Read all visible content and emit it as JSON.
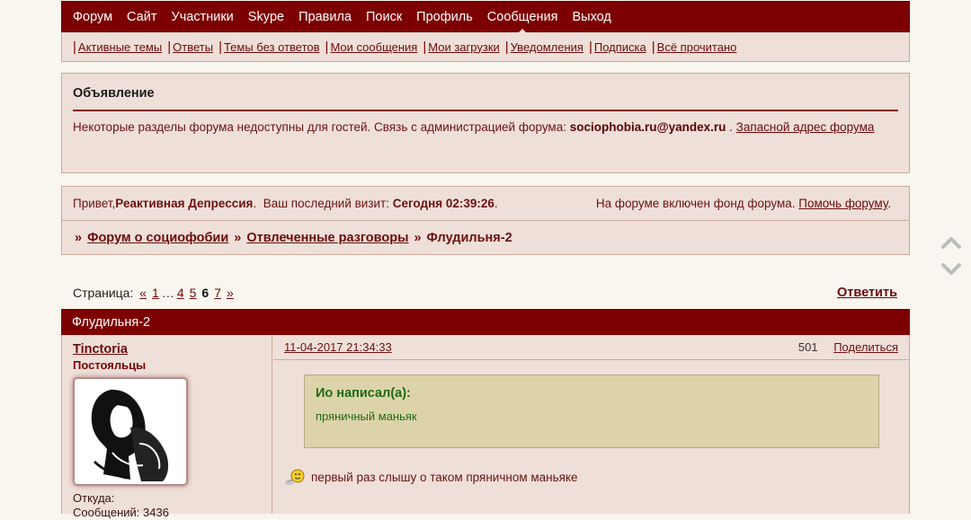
{
  "topnav": [
    "Форум",
    "Сайт",
    "Участники",
    "Skype",
    "Правила",
    "Поиск",
    "Профиль",
    "Сообщения",
    "Выход"
  ],
  "subnav": [
    "Активные темы",
    "Ответы",
    "Темы без ответов",
    "Мои сообщения",
    "Мои загрузки",
    "Уведомления ",
    "Подписка",
    "Всё прочитано"
  ],
  "announcement": {
    "title": "Объявление",
    "text": "Некоторые разделы форума недоступны для гостей. Связь с администрацией форума: ",
    "email": "sociophobia.ru@yandex.ru",
    "dot": " . ",
    "link": "Запасной адрес форума"
  },
  "welcome": {
    "greet": "Привет, ",
    "user": "Реактивная Депрессия",
    "last_label": ".  Ваш последний визит: ",
    "last_value": "Сегодня 02:39:26",
    "end": ".",
    "fund_text": "На форуме включен фонд форума. ",
    "fund_link": "Помочь форуму",
    "fund_end": "."
  },
  "breadcrumb": {
    "sep": "»",
    "items": [
      "Форум о социофобии",
      "Отвлеченные разговоры",
      "Флудильня-2"
    ]
  },
  "pager": {
    "label": "Страница: ",
    "prev": "«",
    "first": "1",
    "ellipsis": "…",
    "p4": "4",
    "p5": "5",
    "current": "6",
    "p7": "7",
    "next": "»"
  },
  "reply_label": "Ответить",
  "topic_title": "Флудильня-2",
  "post": {
    "author": "Tinctoria",
    "rank": "Постояльцы",
    "from_label": "Откуда:",
    "messages_label": "Сообщений: 3436",
    "date": "11-04-2017 21:34:33",
    "number": "501",
    "share": "Поделиться",
    "quote_head": "Ио написал(а):",
    "quote_text": "пряничный маньяк",
    "text": "первый раз слышу о таком пряничном маньяке"
  },
  "colors": {
    "primary": "#7d0000",
    "panel": "#efdfd9",
    "quote_bg": "#ddd3ab",
    "quote_text": "#1f6b14"
  }
}
